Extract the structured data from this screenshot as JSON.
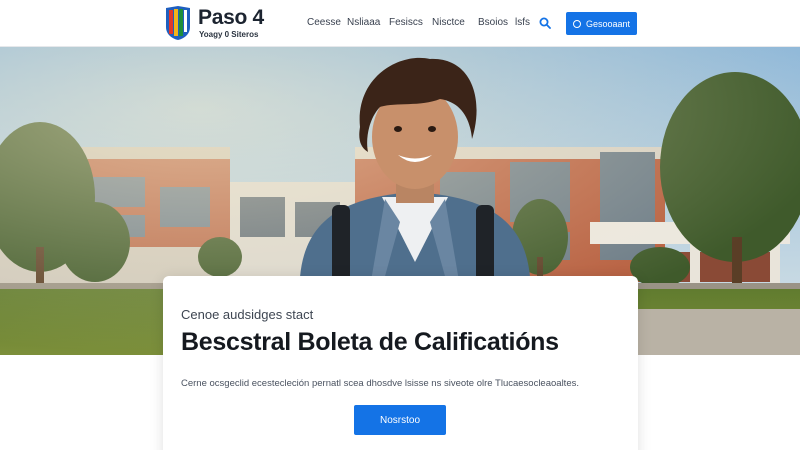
{
  "brand": {
    "title": "Paso 4",
    "subtitle": "Yoagy 0 Siteros",
    "colors": [
      "#e2372b",
      "#f3b31c",
      "#1f8f3a",
      "#1f5fbf"
    ]
  },
  "nav": {
    "items": [
      {
        "label": "Ceesse"
      },
      {
        "label": "Nsliaaa"
      },
      {
        "label": "Fesiscs"
      },
      {
        "label": "Nisctce"
      },
      {
        "label": "Bsoios"
      },
      {
        "label": "lsfs"
      }
    ],
    "search_icon": "search-icon",
    "cta_label": "Gesooaant",
    "cta_icon": "circle-icon",
    "accent": "#1473e6"
  },
  "hero": {
    "kicker": "Cenoe audsidges stact",
    "title": "Bescstral Boleta de Calificatións",
    "description": "Cerne ocsgeclid ecestecleción pernatl scea dhosdve lsisse ns siveote olre Tlucaesocleaoaltes.",
    "button_label": "Nosrstoo"
  }
}
